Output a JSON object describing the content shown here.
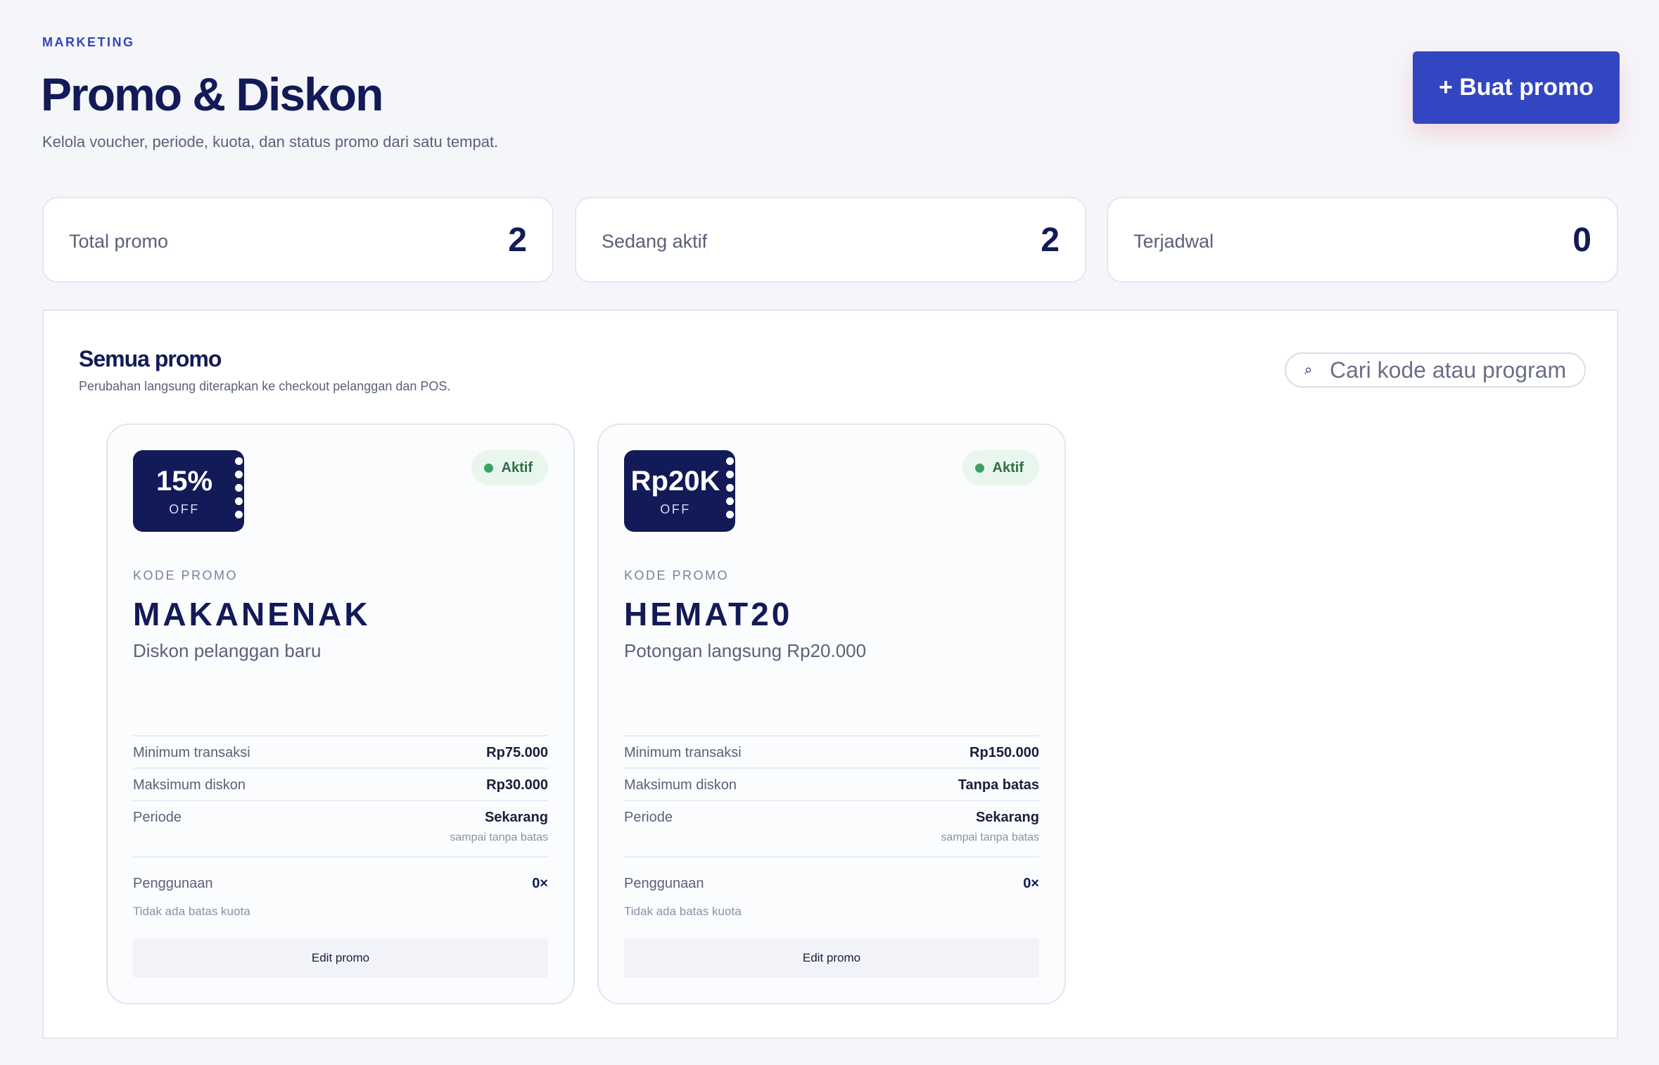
{
  "header": {
    "eyebrow": "MARKETING",
    "title": "Promo & Diskon",
    "subtitle": "Kelola voucher, periode, kuota, dan status promo dari satu tempat.",
    "create_button": "+ Buat promo"
  },
  "stats": [
    {
      "label": "Total promo",
      "value": "2"
    },
    {
      "label": "Sedang aktif",
      "value": "2"
    },
    {
      "label": "Terjadwal",
      "value": "0"
    }
  ],
  "panel": {
    "title": "Semua promo",
    "subtitle": "Perubahan langsung diterapkan ke checkout pelanggan dan POS.",
    "search_placeholder": "Cari kode atau program"
  },
  "promos": [
    {
      "ticket_value": "15%",
      "ticket_off": "OFF",
      "status": "Aktif",
      "code_label": "KODE PROMO",
      "code": "MAKANENAK",
      "description": "Diskon pelanggan baru",
      "min_label": "Minimum transaksi",
      "min_value": "Rp75.000",
      "max_label": "Maksimum diskon",
      "max_value": "Rp30.000",
      "period_label": "Periode",
      "period_value": "Sekarang",
      "period_sub": "sampai tanpa batas",
      "usage_label": "Penggunaan",
      "usage_value": "0×",
      "usage_note": "Tidak ada batas kuota",
      "edit_label": "Edit promo"
    },
    {
      "ticket_value": "Rp20K",
      "ticket_off": "OFF",
      "status": "Aktif",
      "code_label": "KODE PROMO",
      "code": "HEMAT20",
      "description": "Potongan langsung Rp20.000",
      "min_label": "Minimum transaksi",
      "min_value": "Rp150.000",
      "max_label": "Maksimum diskon",
      "max_value": "Tanpa batas",
      "period_label": "Periode",
      "period_value": "Sekarang",
      "period_sub": "sampai tanpa batas",
      "usage_label": "Penggunaan",
      "usage_value": "0×",
      "usage_note": "Tidak ada batas kuota",
      "edit_label": "Edit promo"
    }
  ],
  "icons": {
    "search": "search-icon"
  },
  "colors": {
    "primary": "#3346c2",
    "navy": "#121a57",
    "status_active_bg": "#e8f6ee",
    "status_active_dot": "#3fa067",
    "background": "#f5f6fa"
  }
}
